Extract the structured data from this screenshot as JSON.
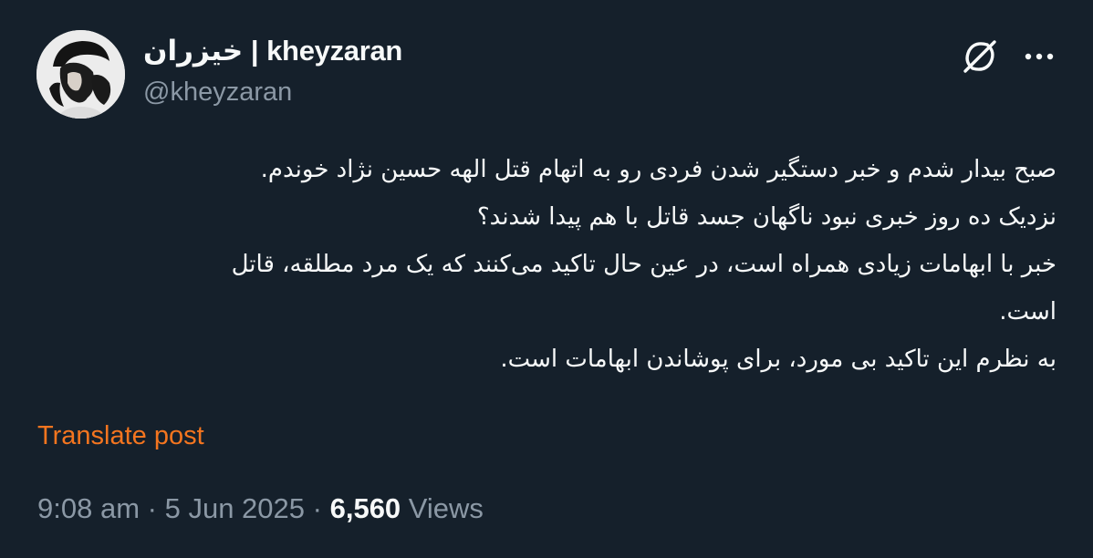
{
  "author": {
    "display_name": "خیزران | kheyzaran",
    "handle": "@kheyzaran"
  },
  "header_icons": {
    "grok": "grok-icon",
    "more": "more-icon"
  },
  "post": {
    "lines": [
      "صبح بیدار شدم و خبر دستگیر شدن فردی رو به اتهام قتل الهه حسین نژاد خوندم.",
      "نزدیک ده روز خبری نبود ناگهان جسد قاتل با هم پیدا شدند؟",
      "خبر با ابهامات زیادی همراه است، در عین حال تاکید می‌کنند که یک مرد مطلقه، قاتل",
      "است.",
      "به نظرم این تاکید بی مورد، برای پوشاندن ابهامات است."
    ],
    "translate_label": "Translate post"
  },
  "meta": {
    "time": "9:08 am",
    "separator": "·",
    "date": "5 Jun 2025",
    "views_count": "6,560",
    "views_label": "Views"
  },
  "colors": {
    "background": "#15202b",
    "text": "#f7f9f9",
    "secondary": "#8b98a5",
    "accent": "#f4751f"
  }
}
